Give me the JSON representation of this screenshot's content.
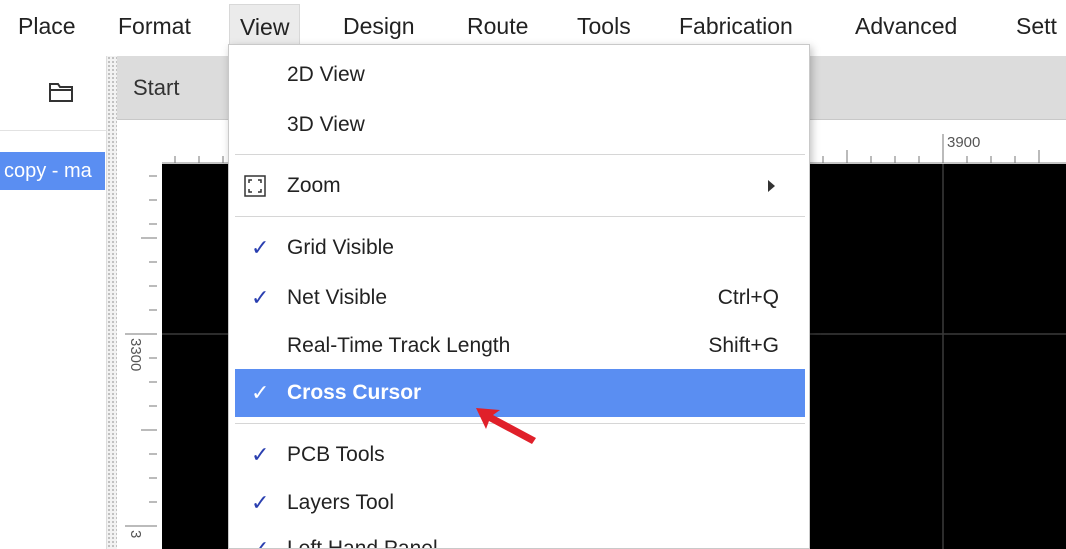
{
  "menubar": {
    "items": [
      "Place",
      "Format",
      "View",
      "Design",
      "Route",
      "Tools",
      "Fabrication",
      "Advanced",
      "Sett"
    ],
    "active": "View"
  },
  "left_panel": {
    "folder_icon": "folder-icon",
    "project_item": "copy - ma"
  },
  "tabs": {
    "start_label": "Start"
  },
  "rulers": {
    "top_label": "3900",
    "left_label_1": "3300",
    "left_label_2": "3"
  },
  "view_menu": {
    "items": [
      {
        "label": "2D View",
        "checked": false,
        "shortcut": ""
      },
      {
        "label": "3D View",
        "checked": false,
        "shortcut": ""
      },
      {
        "label": "Zoom",
        "checked": false,
        "shortcut": "",
        "submenu": true,
        "icon": "zoom-fit-icon"
      },
      {
        "label": "Grid Visible",
        "checked": true,
        "shortcut": ""
      },
      {
        "label": "Net Visible",
        "checked": true,
        "shortcut": "Ctrl+Q"
      },
      {
        "label": "Real-Time Track Length",
        "checked": false,
        "shortcut": "Shift+G"
      },
      {
        "label": "Cross Cursor",
        "checked": true,
        "shortcut": "",
        "highlighted": true
      },
      {
        "label": "PCB Tools",
        "checked": true,
        "shortcut": ""
      },
      {
        "label": "Layers Tool",
        "checked": true,
        "shortcut": ""
      },
      {
        "label": "Left Hand Panel",
        "checked": true,
        "shortcut": ""
      }
    ],
    "check_glyph": "✓"
  },
  "colors": {
    "highlight": "#5a8ef2",
    "check": "#2a3fb0",
    "canvas": "#000000",
    "annotation_arrow": "#e0202a"
  },
  "annotation": {
    "icon": "red-arrow-icon"
  }
}
